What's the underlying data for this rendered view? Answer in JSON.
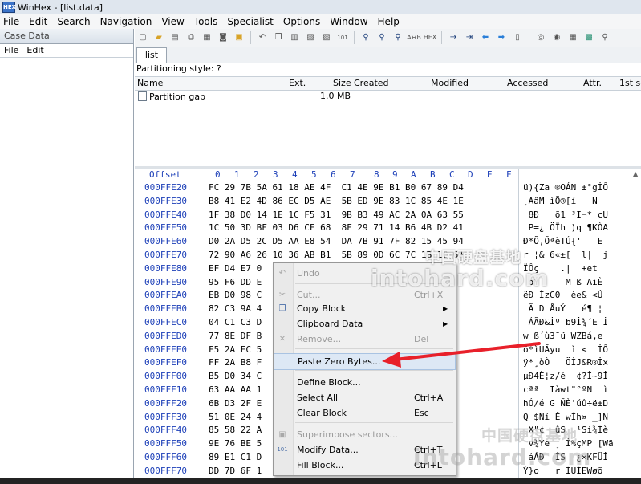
{
  "window": {
    "title": "WinHex - [list.data]",
    "app_icon_text": "HEX"
  },
  "menubar": [
    "File",
    "Edit",
    "Search",
    "Navigation",
    "View",
    "Tools",
    "Specialist",
    "Options",
    "Window",
    "Help"
  ],
  "case_panel": {
    "header": "Case Data",
    "menu": [
      "File",
      "Edit"
    ]
  },
  "tab": {
    "label": "list"
  },
  "partition_style": "Partitioning style: ?",
  "directory": {
    "columns": [
      "Name",
      "Ext.",
      "Size",
      "Created",
      "Modified",
      "Accessed",
      "Attr.",
      "1st se"
    ],
    "rows": [
      {
        "name": "Partition gap",
        "ext": "",
        "size": "1.0 MB"
      }
    ]
  },
  "hex": {
    "offset_label": "Offset",
    "columns": [
      "0",
      "1",
      "2",
      "3",
      "4",
      "5",
      "6",
      "7",
      "8",
      "9",
      "A",
      "B",
      "C",
      "D",
      "E",
      "F"
    ],
    "rows": [
      {
        "offset": "000FFE20",
        "bytes": "FC 29 7B 5A 61 18 AE 4F  C1 4E 9E B1 B0 67 89 D4",
        "text": "ü){Za ®OÁN ±°gİÔ"
      },
      {
        "offset": "000FFE30",
        "bytes": "B8 41 E2 4D 86 EC D5 AE  5B ED 9E 83 1C 85 4E 1E",
        "text": "¸AâM ìÕ®[í   N "
      },
      {
        "offset": "000FFE40",
        "bytes": "1F 38 D0 14 1E 1C F5 31  9B B3 49 AC 2A 0A 63 55",
        "text": " 8Ð   õ1 ³I¬* cU"
      },
      {
        "offset": "000FFE50",
        "bytes": "1C 50 3D BF 03 D6 CF 68  8F 29 71 14 B6 4B D2 41",
        "text": " P=¿ ÖÏh )q ¶KÒA"
      },
      {
        "offset": "000FFE60",
        "bytes": "D0 2A D5 2C D5 AA E8 54  DA 7B 91 7F 82 15 45 94",
        "text": "Ð*Õ,ÕªèTÚ{'   E "
      },
      {
        "offset": "000FFE70",
        "bytes": "72 90 A6 26 10 36 AB B1  5B 89 0D 6C 7C 1B 1C 6A",
        "text": "r ¦& 6«±[  l|  j"
      },
      {
        "offset": "000FFE80",
        "bytes": "EF D4 E7 0",
        "text": "ÏÔç    .|  +et"
      },
      {
        "offset": "000FFE90",
        "bytes": "95 F6 DD E",
        "text": " öÝ     M ß AiÈ_"
      },
      {
        "offset": "000FFEA0",
        "bytes": "EB D0 98 C",
        "text": "ëÐ İzG0  èe& <Ú"
      },
      {
        "offset": "000FFEB0",
        "bytes": "82 C3 9A 4",
        "text": " Ã D ÅuÝ   é¶ ¦"
      },
      {
        "offset": "000FFEC0",
        "bytes": "04 C1 C3 D",
        "text": " ÁÃÐ&İº b9İ¾´E İ"
      },
      {
        "offset": "000FFED0",
        "bytes": "77 8E DF B",
        "text": "w ß´ù3¯ü WZBá,e"
      },
      {
        "offset": "000FFEE0",
        "bytes": "F5 2A EC 5",
        "text": "õ*ìUÃyu  ì <  İÔ"
      },
      {
        "offset": "000FFEF0",
        "bytes": "FF 2A B8 F",
        "text": "ÿ*¸òÒ   ÖİJ&R®İx"
      },
      {
        "offset": "000FFF00",
        "bytes": "B5 D0 34 C",
        "text": "µÐ4È¦z/é  ¢?İ~9İ"
      },
      {
        "offset": "000FFF10",
        "bytes": "63 AA AA 1",
        "text": "cªª  Iàwt\"°ºN  ì"
      },
      {
        "offset": "000FFF20",
        "bytes": "6B D3 2F E",
        "text": "hÓ/é G ÑÈ'úû÷ë±D"
      },
      {
        "offset": "000FFF30",
        "bytes": "51 0E 24 4",
        "text": "Q $Ní Ê wÍh¤ _]N"
      },
      {
        "offset": "000FFF40",
        "bytes": "85 58 22 A",
        "text": " X\"¢  ûS  ¹Si¾İè"
      },
      {
        "offset": "000FFF50",
        "bytes": "9E 76 BE 5",
        "text": " v¾Ye ¸ İ%çMP [Wã"
      },
      {
        "offset": "000FFF60",
        "bytes": "89 E1 C1 D",
        "text": " áÁÐ  İS  ¿×KFÜİ"
      },
      {
        "offset": "000FFF70",
        "bytes": "DD 7D 6F 1",
        "text": "Ý}o   r İÜİEWøõ"
      }
    ]
  },
  "context_menu": {
    "items": [
      {
        "id": "undo",
        "label": "Undo",
        "shortcut": "",
        "icon": "undo-icon",
        "glyph": "↶",
        "disabled": true
      },
      {
        "id": "cut",
        "label": "Cut...",
        "shortcut": "Ctrl+X",
        "icon": "scissors-icon",
        "glyph": "✂",
        "disabled": true
      },
      {
        "id": "copy-block",
        "label": "Copy Block",
        "shortcut": "",
        "icon": "copy-icon",
        "glyph": "❐",
        "submenu": true
      },
      {
        "id": "clipboard-data",
        "label": "Clipboard Data",
        "shortcut": "",
        "icon": "",
        "glyph": "",
        "submenu": true
      },
      {
        "id": "remove",
        "label": "Remove...",
        "shortcut": "Del",
        "icon": "remove-icon",
        "glyph": "✕",
        "disabled": true
      },
      {
        "id": "paste-zero",
        "label": "Paste Zero Bytes...",
        "shortcut": "",
        "icon": "",
        "glyph": "",
        "highlighted": true
      },
      {
        "id": "define-block",
        "label": "Define Block...",
        "shortcut": "",
        "icon": "",
        "glyph": ""
      },
      {
        "id": "select-all",
        "label": "Select All",
        "shortcut": "Ctrl+A",
        "icon": "",
        "glyph": ""
      },
      {
        "id": "clear-block",
        "label": "Clear Block",
        "shortcut": "Esc",
        "icon": "",
        "glyph": ""
      },
      {
        "id": "superimpose",
        "label": "Superimpose sectors...",
        "shortcut": "",
        "icon": "superimpose-icon",
        "glyph": "▣",
        "disabled": true
      },
      {
        "id": "modify-data",
        "label": "Modify Data...",
        "shortcut": "Ctrl+T",
        "icon": "modify-data-icon",
        "glyph": "101",
        "disabled": false
      },
      {
        "id": "fill-block",
        "label": "Fill Block...",
        "shortcut": "Ctrl+L",
        "icon": "",
        "glyph": ""
      }
    ]
  },
  "watermark": {
    "cn": "中国硬盘基地",
    "en": "intohard.com"
  },
  "annotation_color": "#e8202a"
}
